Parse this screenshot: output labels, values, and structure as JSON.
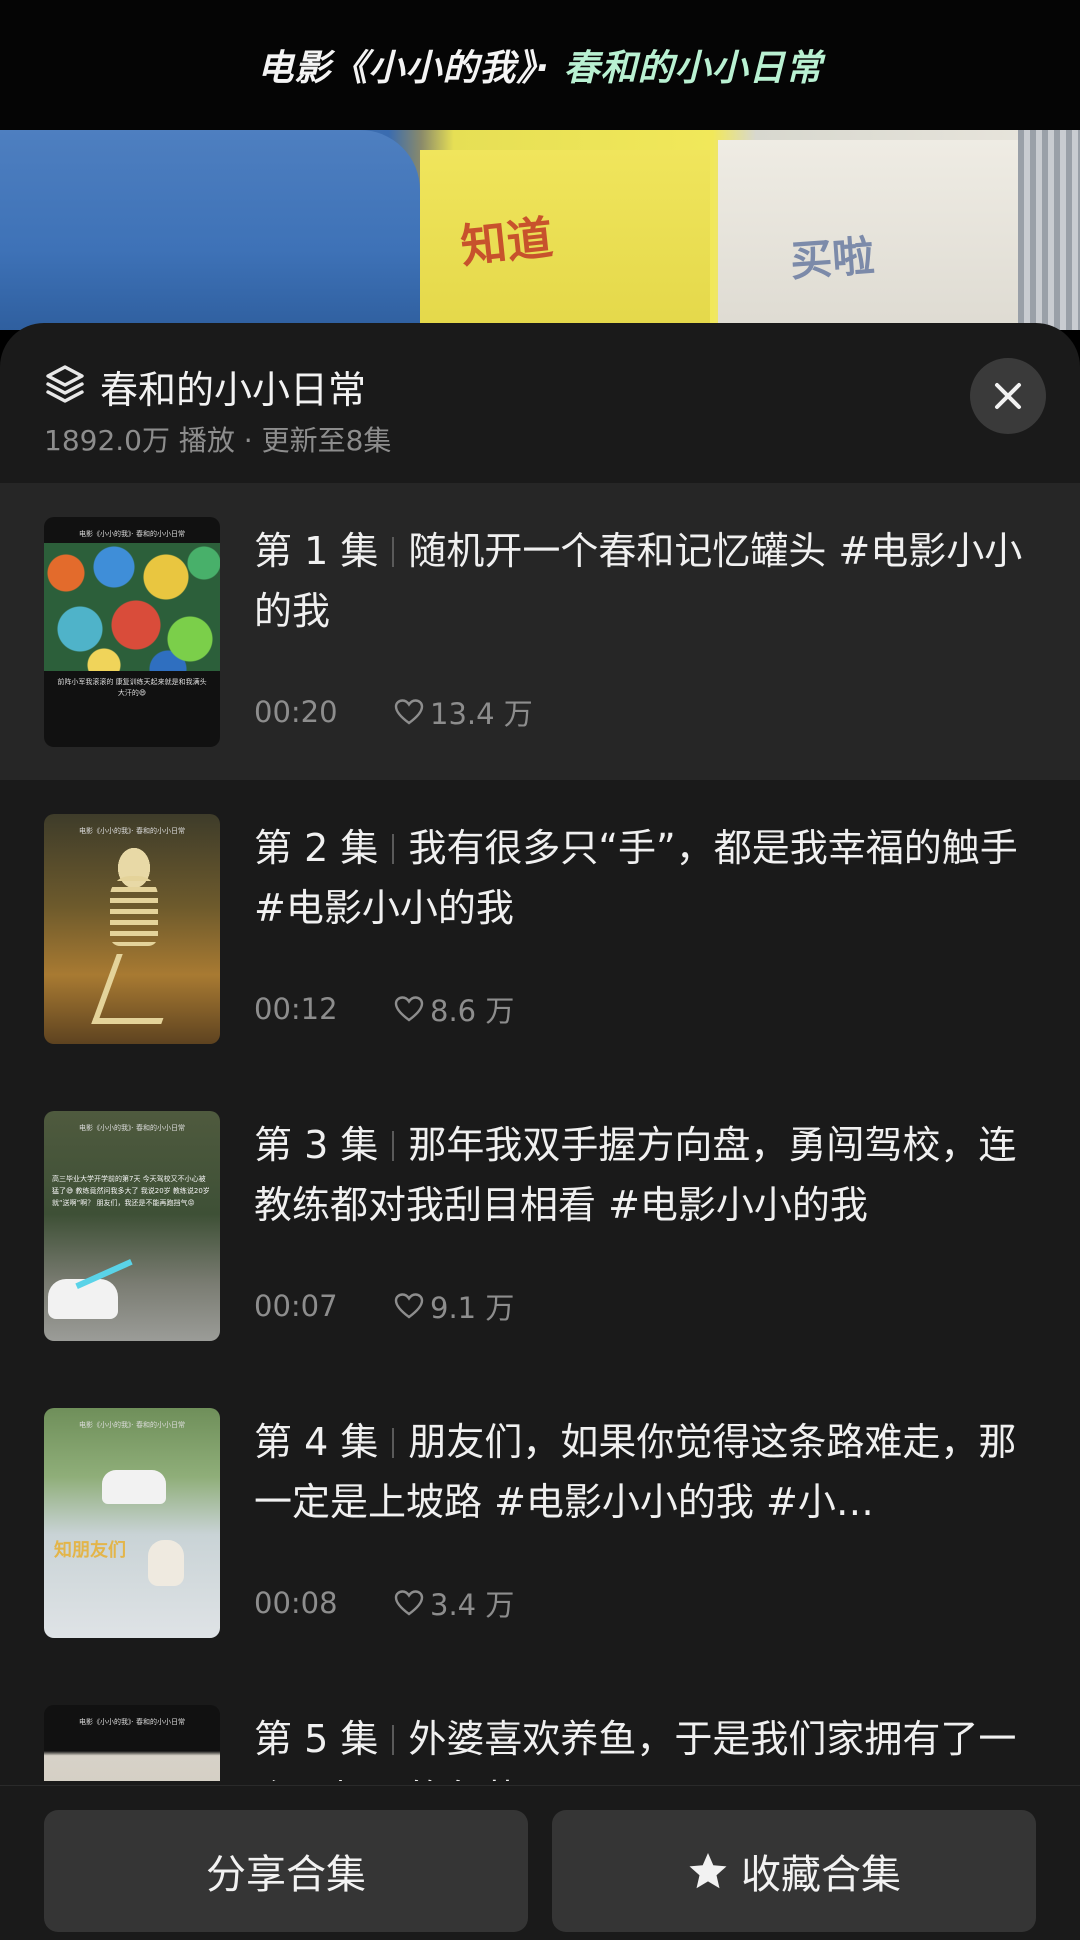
{
  "video": {
    "title_prefix": "电影《小小的我》· ",
    "title_accent": "春和的小小日常",
    "frame_marks": [
      "知道",
      "买啦"
    ]
  },
  "panel": {
    "title": "春和的小小日常",
    "meta": "1892.0万 播放 · 更新至8集",
    "close_icon": "close-icon",
    "stack_icon": "stack-icon"
  },
  "episodes": [
    {
      "number": "第 1 集",
      "title": "随机开一个春和记忆罐头 #电影小小的我",
      "duration": "00:20",
      "likes": "13.4 万",
      "active": true,
      "thumb_caption": "电影《小小的我》· 春和的小小日常",
      "thumb_text": "前阵小军我滚滚的 康复训练天起来就是和我满头大汗的😄"
    },
    {
      "number": "第 2 集",
      "title": "我有很多只“手”，都是我幸福的触手#电影小小的我",
      "duration": "00:12",
      "likes": "8.6 万",
      "active": false,
      "thumb_caption": "电影《小小的我》· 春和的小小日常"
    },
    {
      "number": "第 3 集",
      "title": "那年我双手握方向盘，勇闯驾校，连教练都对我刮目相看 #电影小小的我",
      "duration": "00:07",
      "likes": "9.1 万",
      "active": false,
      "thumb_caption": "电影《小小的我》· 春和的小小日常",
      "thumb_text": "高三毕业大学开学前的第7天 今天驾校又不小心被猛了😅 教练竟然问我多大了 我说20岁 教练说20岁就“送啊”啊？ 朋友们，我还是不能再跑挡气😡"
    },
    {
      "number": "第 4 集",
      "title": "朋友们，如果你觉得这条路难走，那一定是上坡路 #电影小小的我 #小…",
      "duration": "00:08",
      "likes": "3.4 万",
      "active": false,
      "thumb_caption": "电影《小小的我》· 春和的小小日常",
      "thumb_text": "知朋友们"
    },
    {
      "number": "第 5 集",
      "title": "外婆喜欢养鱼，于是我们家拥有了一个不起眼的角落",
      "duration": "",
      "likes": "",
      "active": false,
      "thumb_caption": "电影《小小的我》· 春和的小小日常"
    }
  ],
  "footer": {
    "share_label": "分享合集",
    "favorite_label": "收藏合集",
    "favorite_icon": "star-icon"
  },
  "colors": {
    "panel_bg": "#1a1a1a",
    "active_row": "#262626",
    "button_bg": "#353535",
    "muted_text": "#8d8d8d",
    "title_accent": "#b9f1d2"
  }
}
